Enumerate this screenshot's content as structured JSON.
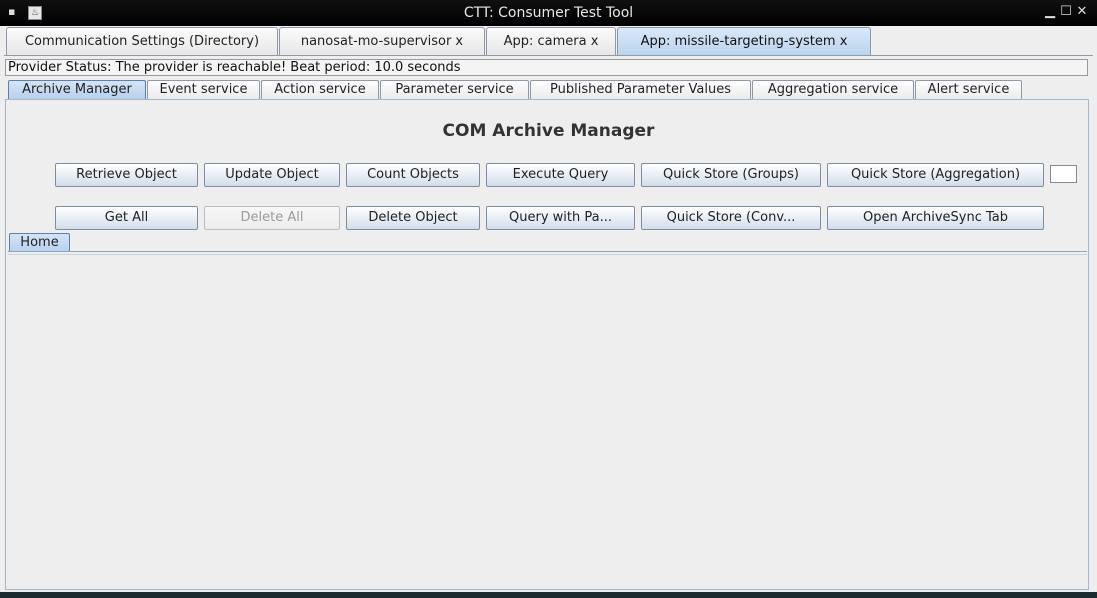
{
  "window": {
    "title": "CTT: Consumer Test Tool"
  },
  "top_tabs": [
    {
      "label": "Communication Settings (Directory)"
    },
    {
      "label": "nanosat-mo-supervisor x"
    },
    {
      "label": "App: camera x"
    },
    {
      "label": "App: missile-targeting-system x"
    }
  ],
  "status": {
    "text": "Provider Status: The provider is reachable! Beat period: 10.0 seconds"
  },
  "service_tabs": [
    {
      "label": "Archive Manager"
    },
    {
      "label": "Event service"
    },
    {
      "label": "Action service"
    },
    {
      "label": "Parameter service"
    },
    {
      "label": "Published Parameter Values"
    },
    {
      "label": "Aggregation service"
    },
    {
      "label": "Alert service"
    }
  ],
  "archive": {
    "title": "COM Archive Manager",
    "row1": [
      "Retrieve Object",
      "Update Object",
      "Count Objects",
      "Execute Query",
      "Quick Store (Groups)",
      "Quick Store (Aggregation)"
    ],
    "row2": [
      "Get All",
      "Delete All",
      "Delete Object",
      "Query with Pa...",
      "Quick Store (Conv...",
      "Open ArchiveSync Tab"
    ]
  },
  "inner_tabs": [
    {
      "label": "Home"
    }
  ],
  "selected": {
    "top_tab": 3,
    "service_tab": 0
  },
  "colors": {
    "selected_tab": "#bcd4ee",
    "titlebar": "#000000"
  }
}
